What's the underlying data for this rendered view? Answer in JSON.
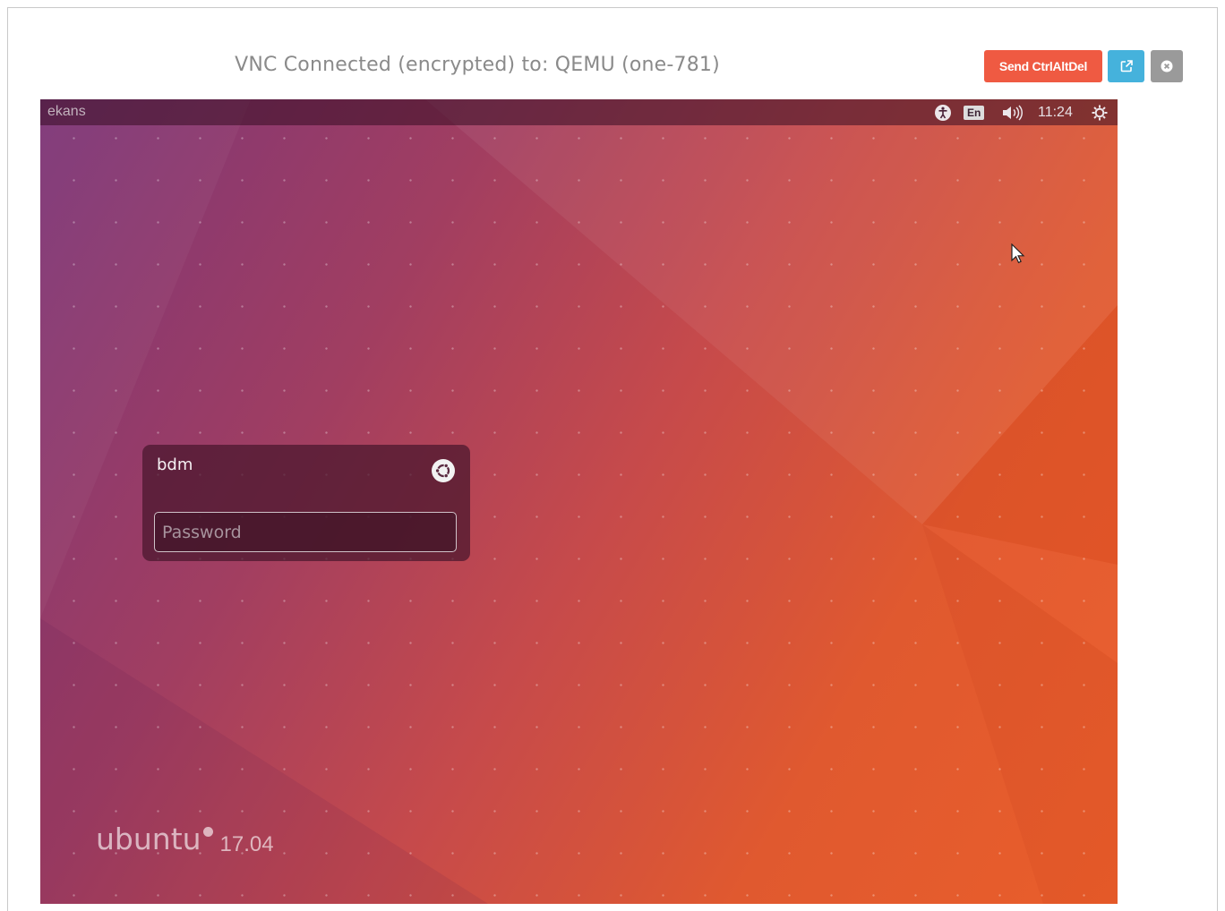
{
  "header": {
    "title": "VNC Connected (encrypted) to: QEMU (one-781)",
    "send_ctrl_alt_del_label": "Send CtrlAltDel",
    "popout_icon": "external-link-icon",
    "close_icon": "close-circle-icon"
  },
  "vm": {
    "topbar": {
      "hostname": "ekans",
      "language": "En",
      "time": "11:24",
      "icons": [
        "accessibility-icon",
        "volume-icon",
        "power-gear-icon"
      ]
    },
    "login": {
      "username": "bdm",
      "password_placeholder": "Password",
      "session_icon": "ubuntu-session-icon"
    },
    "branding": {
      "name": "ubuntu",
      "version": "17.04"
    }
  },
  "colors": {
    "send_button": "#ef5a42",
    "popout_button": "#45b2dc",
    "close_button": "#9a9a9a",
    "wallpaper_purple": "#7d3678",
    "wallpaper_orange": "#e95e2b"
  }
}
